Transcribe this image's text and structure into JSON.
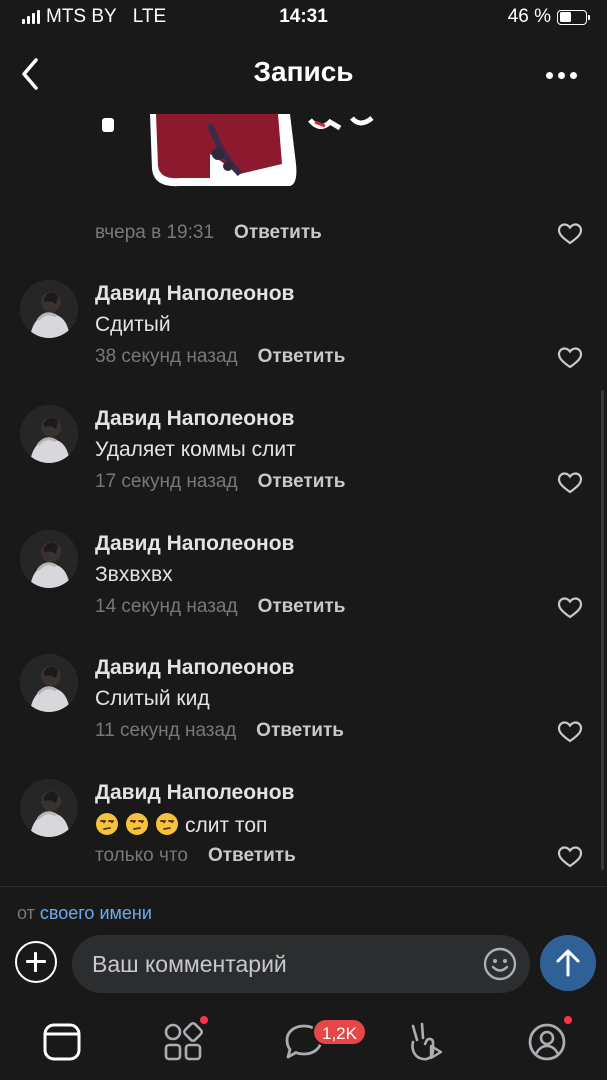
{
  "status_bar": {
    "carrier": "MTS BY",
    "network": "LTE",
    "time": "14:31",
    "battery": "46 %",
    "battery_level": 0.46
  },
  "header": {
    "title": "Запись",
    "back_icon": "chevron-left-icon",
    "more_icon": "more-horizontal-icon"
  },
  "sticker_comment": {
    "time": "вчера в 19:31",
    "reply_label": "Ответить"
  },
  "comments": [
    {
      "author": "Давид Наполеонов",
      "text": "Сдитый",
      "time": "38 секунд назад",
      "reply_label": "Ответить"
    },
    {
      "author": "Давид Наполеонов",
      "text": "Удаляет коммы слит",
      "time": "17 секунд назад",
      "reply_label": "Ответить"
    },
    {
      "author": "Давид Наполеонов",
      "text": "Звхвхвх",
      "time": "14 секунд назад",
      "reply_label": "Ответить"
    },
    {
      "author": "Давид Наполеонов",
      "text": "Слитый кид",
      "time": "11 секунд назад",
      "reply_label": "Ответить"
    },
    {
      "author": "Давид Наполеонов",
      "text": "слит топ",
      "text_emoji": "😒😒😒",
      "time": "только что",
      "reply_label": "Ответить"
    }
  ],
  "composer": {
    "from_prefix": "от",
    "from_link": "своего имени",
    "placeholder": "Ваш комментарий"
  },
  "tabbar": {
    "items": [
      "news-icon",
      "services-icon",
      "messages-icon",
      "clips-icon",
      "profile-icon"
    ],
    "messages_badge": "1,2K"
  },
  "colors": {
    "background": "#191919",
    "accent": "#71aaeb",
    "send_button": "#2f6197",
    "badge": "#e64646"
  }
}
